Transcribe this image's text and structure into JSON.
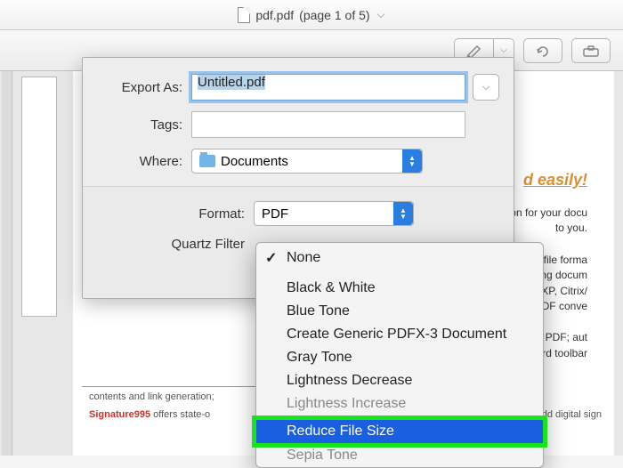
{
  "titlebar": {
    "filename": "pdf.pdf",
    "page_info": "(page 1 of 5)"
  },
  "dialog": {
    "export_as_label": "Export As:",
    "export_as_value": "Untitled.pdf",
    "tags_label": "Tags:",
    "tags_value": "",
    "where_label": "Where:",
    "where_value": "Documents",
    "format_label": "Format:",
    "format_value": "PDF",
    "quartz_label": "Quartz Filter"
  },
  "quartz_menu": {
    "selected": "None",
    "items": [
      "Black & White",
      "Blue Tone",
      "Create Generic PDFX-3 Document",
      "Gray Tone",
      "Lightness Decrease",
      "Lightness Increase",
      "Reduce File Size",
      "Sepia Tone"
    ],
    "highlighted_index": 6
  },
  "background_doc": {
    "accent": "d easily!",
    "para1a": "lution for your docu",
    "para1b": "to you.",
    "para2a": "ar PDF file forma",
    "para2b": "creating docum",
    "para2c": "ng on XP, Citrix/",
    "para2d": "ot to PDF conve",
    "para3a": "single PDF; aut",
    "para3b": "ith Word toolbar",
    "foot1": "contents and link generation;",
    "sig_label": "Signature995",
    "sig_rest": " offers state-o",
    "foot2": "dd digital sign"
  }
}
